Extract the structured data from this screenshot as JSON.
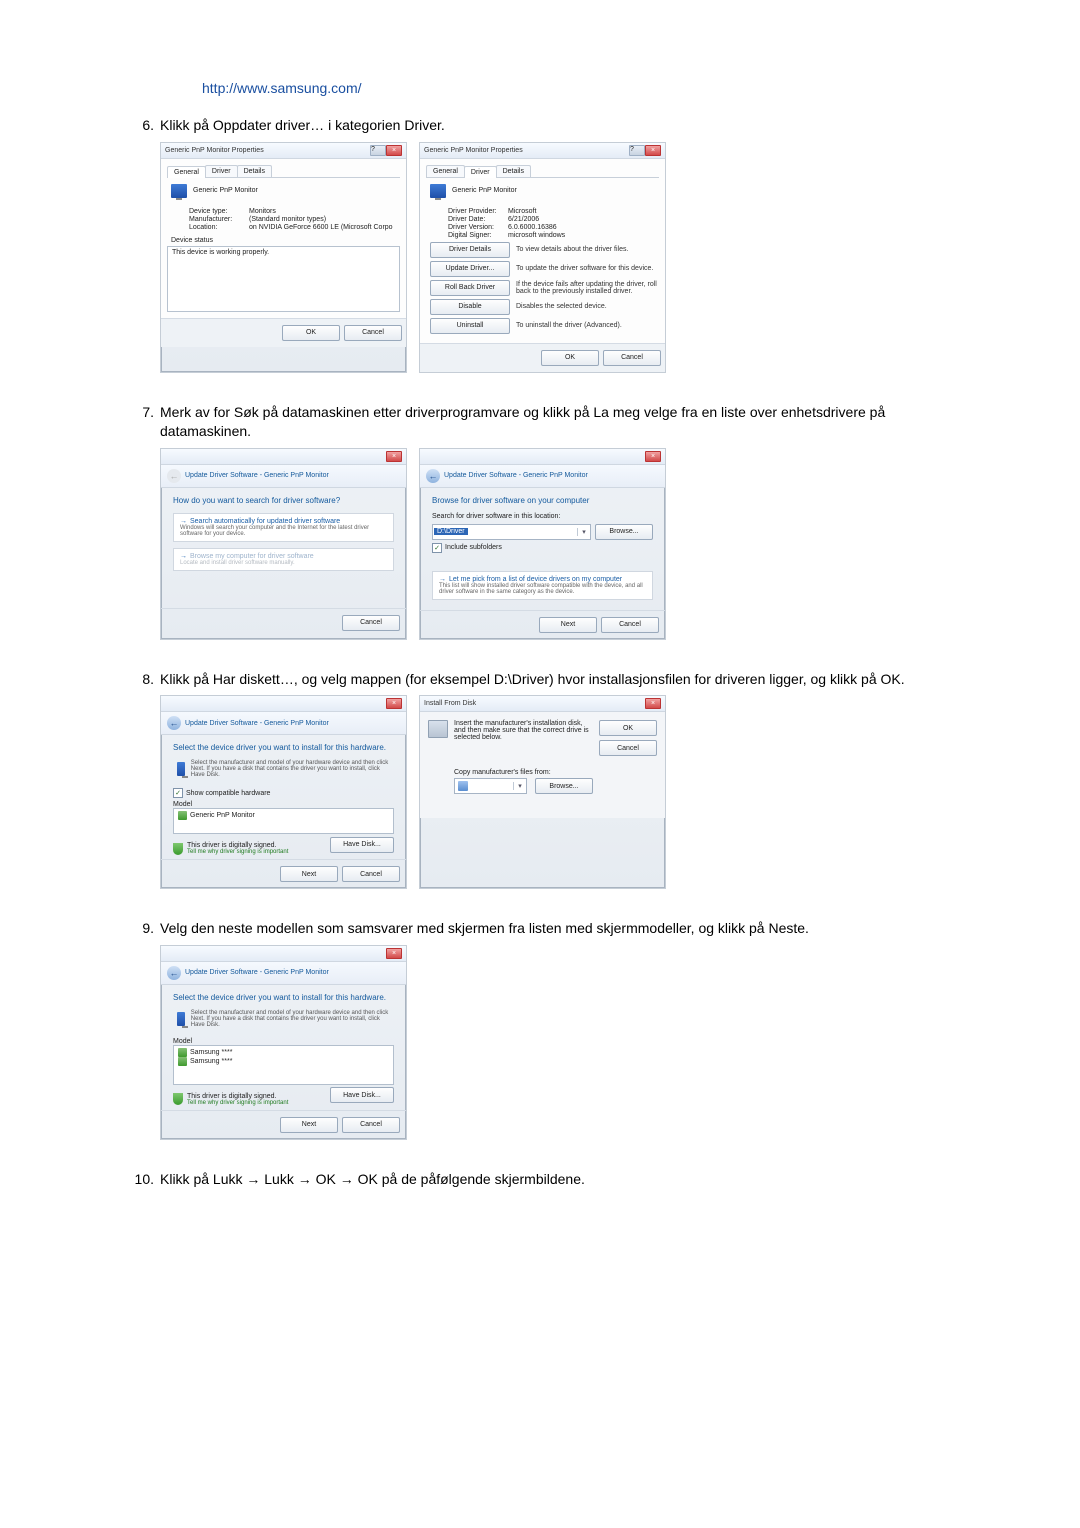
{
  "url": "http://www.samsung.com/",
  "steps": {
    "s6": "Klikk på Oppdater driver… i kategorien Driver.",
    "s7": "Merk av for Søk på datamaskinen etter driverprogramvare og klikk på La meg velge fra en liste over enhetsdrivere på datamaskinen.",
    "s8": "Klikk på Har diskett…, og velg mappen (for eksempel D:\\Driver) hvor installasjonsfilen for driveren ligger, og klikk på OK.",
    "s9": "Velg den neste modellen som samsvarer med skjermen fra listen med skjermmodeller, og klikk på Neste.",
    "s10": "Klikk på Lukk → Lukk → OK → OK på de påfølgende skjermbildene."
  },
  "props": {
    "title": "Generic PnP Monitor Properties",
    "tabs": {
      "general": "General",
      "driver": "Driver",
      "details": "Details"
    },
    "header": "Generic PnP Monitor",
    "general": {
      "device_type_k": "Device type:",
      "device_type_v": "Monitors",
      "manufacturer_k": "Manufacturer:",
      "manufacturer_v": "(Standard monitor types)",
      "location_k": "Location:",
      "location_v": "on NVIDIA GeForce 6600 LE (Microsoft Corpo",
      "status_label": "Device status",
      "status_text": "This device is working properly."
    },
    "drv": {
      "provider_k": "Driver Provider:",
      "provider_v": "Microsoft",
      "date_k": "Driver Date:",
      "date_v": "6/21/2006",
      "version_k": "Driver Version:",
      "version_v": "6.0.6000.16386",
      "signer_k": "Digital Signer:",
      "signer_v": "microsoft windows",
      "btn_details": "Driver Details",
      "btn_details_d": "To view details about the driver files.",
      "btn_update": "Update Driver...",
      "btn_update_d": "To update the driver software for this device.",
      "btn_roll": "Roll Back Driver",
      "btn_roll_d": "If the device fails after updating the driver, roll back to the previously installed driver.",
      "btn_disable": "Disable",
      "btn_disable_d": "Disables the selected device.",
      "btn_uninstall": "Uninstall",
      "btn_uninstall_d": "To uninstall the driver (Advanced)."
    },
    "ok": "OK",
    "cancel": "Cancel"
  },
  "wiz": {
    "title": "Update Driver Software - Generic PnP Monitor",
    "how_q": "How do you want to search for driver software?",
    "opt_auto_t": "Search automatically for updated driver software",
    "opt_auto_s": "Windows will search your computer and the Internet for the latest driver software for your device.",
    "opt_browse_t": "Browse my computer for driver software",
    "opt_browse_s": "Locate and install driver software manually.",
    "browse_head": "Browse for driver software on your computer",
    "search_label": "Search for driver software in this location:",
    "path_value": "D:\\Driver",
    "browse_btn": "Browse...",
    "include_sub": "Include subfolders",
    "letme_t": "Let me pick from a list of device drivers on my computer",
    "letme_s": "This list will show installed driver software compatible with the device, and all driver software in the same category as the device.",
    "next": "Next",
    "cancel": "Cancel"
  },
  "sel": {
    "head": "Select the device driver you want to install for this hardware.",
    "sub": "Select the manufacturer and model of your hardware device and then click Next. If you have a disk that contains the driver you want to install, click Have Disk.",
    "show_compat": "Show compatible hardware",
    "model_label": "Model",
    "model_generic": "Generic PnP Monitor",
    "model_s1": "Samsung ****",
    "model_s2": "Samsung ****",
    "signed": "This driver is digitally signed.",
    "tellme": "Tell me why driver signing is important",
    "have_disk": "Have Disk...",
    "next": "Next",
    "cancel": "Cancel"
  },
  "ifd": {
    "title": "Install From Disk",
    "text1": "Insert the manufacturer's installation disk, and then make sure that the correct drive is selected below.",
    "copy_label": "Copy manufacturer's files from:",
    "ok": "OK",
    "cancel": "Cancel",
    "browse": "Browse..."
  }
}
